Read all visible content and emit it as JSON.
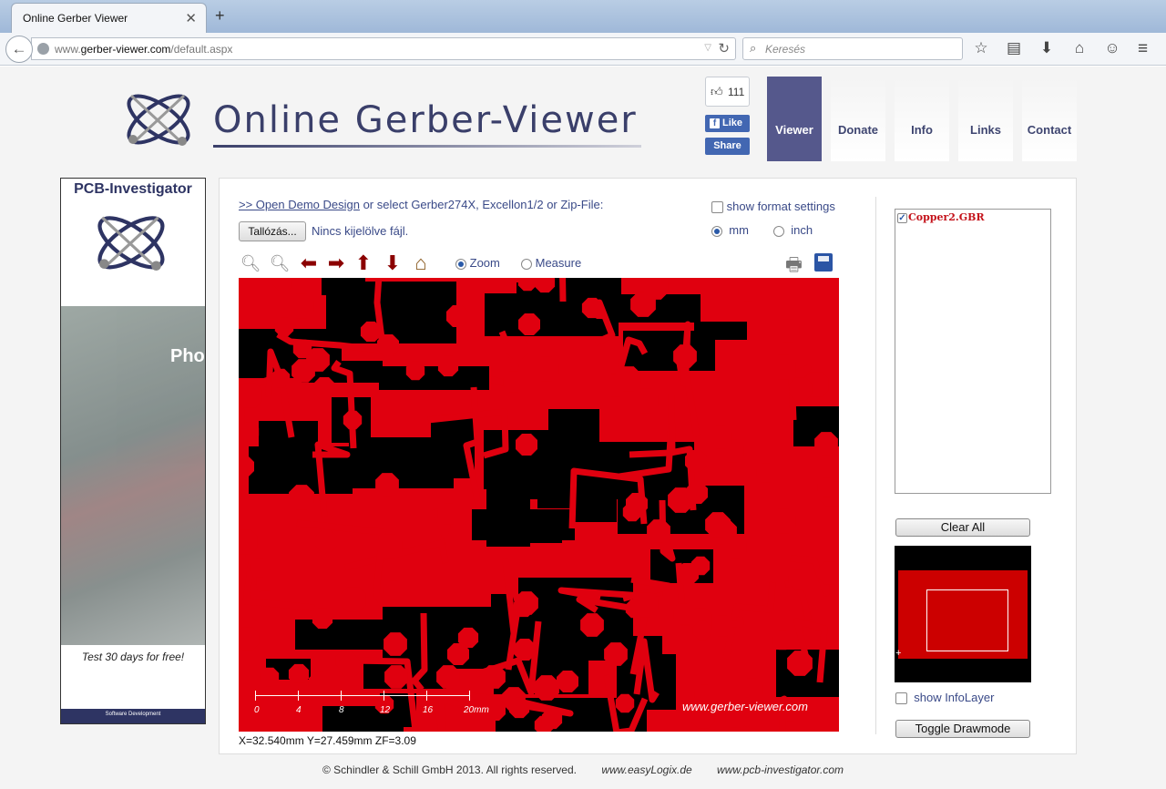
{
  "browser": {
    "tab_title": "Online Gerber Viewer",
    "url_prefix": "www.",
    "url_host": "gerber-viewer.com",
    "url_path": "/default.aspx",
    "search_placeholder": "Keresés"
  },
  "header": {
    "title": "Online Gerber-Viewer",
    "fb_count": "111",
    "fb_like": "Like",
    "fb_share": "Share",
    "nav": [
      "Viewer",
      "Donate",
      "Info",
      "Links",
      "Contact"
    ],
    "active_nav": "Viewer"
  },
  "ad": {
    "title": "PCB-Investigator",
    "photo_text": "Pho",
    "trial": "Test 30 days for free!",
    "footer": "Software Development"
  },
  "viewer": {
    "demo_link": ">> Open Demo Design",
    "demo_rest": " or select Gerber274X, Excellon1/2 or Zip-File:",
    "browse_label": "Tallózás...",
    "no_file": "Nincs kijelölve fájl.",
    "format_settings": "show format settings",
    "unit_mm": "mm",
    "unit_inch": "inch",
    "selected_unit": "mm",
    "mode_zoom": "Zoom",
    "mode_measure": "Measure",
    "selected_mode": "Zoom",
    "watermark": "www.gerber-viewer.com",
    "scale_labels": [
      "0",
      "4",
      "8",
      "12",
      "16",
      "20mm"
    ],
    "coords": "X=32.540mm  Y=27.459mm  ZF=3.09",
    "colors": {
      "board": "#e0000f",
      "background": "#000000",
      "accent": "#55588c"
    }
  },
  "sidebar": {
    "layers": [
      {
        "name": "Copper2.GBR",
        "checked": true
      }
    ],
    "clear_all": "Clear All",
    "show_infolayer": "show InfoLayer",
    "toggle_drawmode": "Toggle Drawmode"
  },
  "footer": {
    "copyright": "© Schindler & Schill GmbH 2013. All rights reserved.",
    "link1": "www.easyLogix.de",
    "link2": "www.pcb-investigator.com"
  }
}
